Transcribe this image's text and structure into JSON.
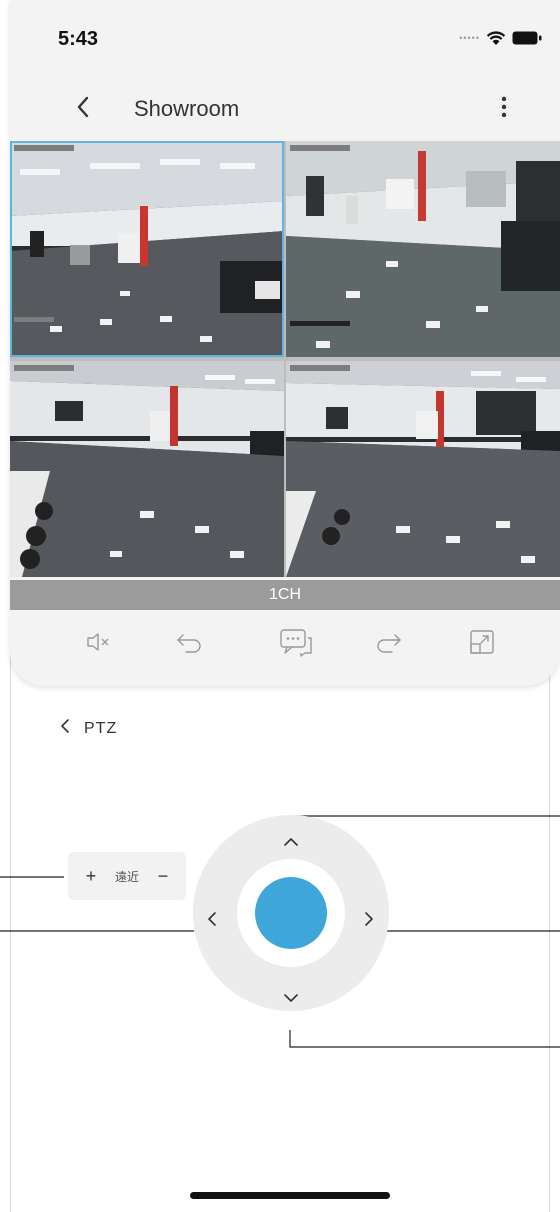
{
  "status": {
    "time": "5:43"
  },
  "nav": {
    "title": "Showroom",
    "back_icon": "chevron-left-icon",
    "more_icon": "vertical-ellipsis-icon"
  },
  "video_grid": {
    "tiles": [
      {
        "name": "camera-tile-1",
        "selected": true
      },
      {
        "name": "camera-tile-2",
        "selected": false
      },
      {
        "name": "camera-tile-3",
        "selected": false
      },
      {
        "name": "camera-tile-4",
        "selected": false
      }
    ]
  },
  "channel": {
    "label": "1CH"
  },
  "toolbar": {
    "items": [
      {
        "icon": "mute-speaker-icon"
      },
      {
        "icon": "undo-arrow-icon"
      },
      {
        "icon": "chat-bubble-icon"
      },
      {
        "icon": "redo-arrow-icon"
      },
      {
        "icon": "fullscreen-expand-icon"
      }
    ]
  },
  "ptz": {
    "title": "PTZ",
    "zoom": {
      "plus": "+",
      "label": "遠近",
      "minus": "−"
    }
  },
  "colors": {
    "accent": "#3ea6d9",
    "selected_border": "#5fb3e0",
    "channel_bar": "#9b9b9b",
    "card_bg": "#f3f3f3"
  }
}
